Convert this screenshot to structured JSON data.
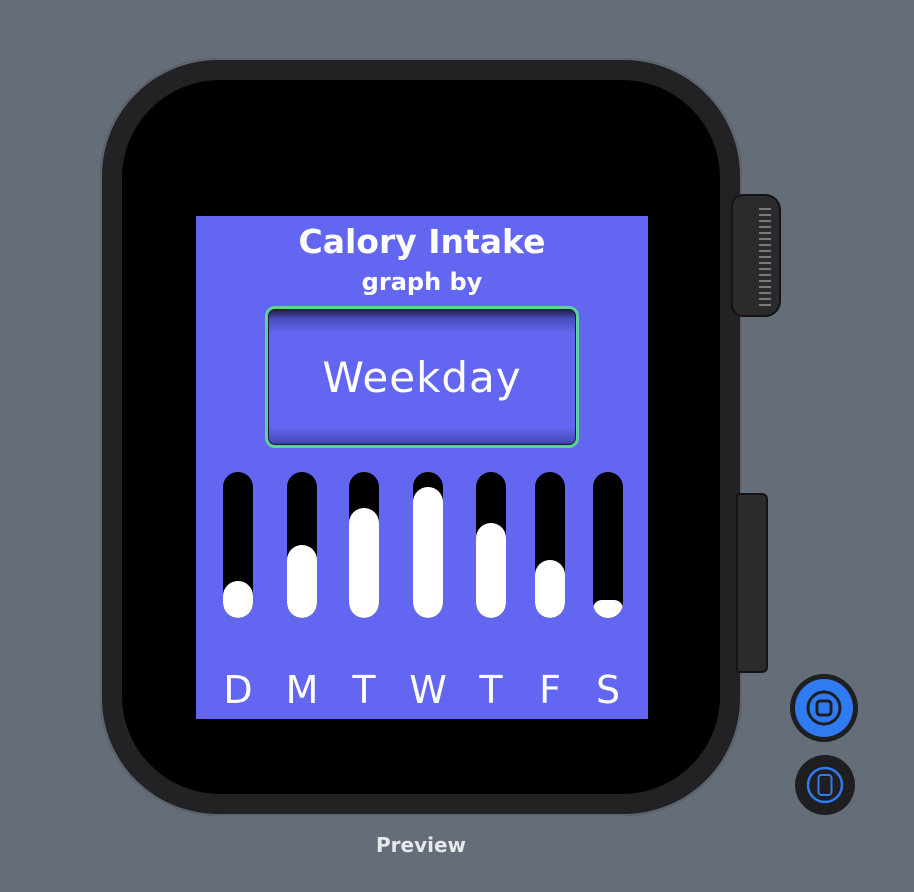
{
  "canvas": {
    "background": "#646d78"
  },
  "app": {
    "title": "Calory Intake",
    "subtitle": "graph by",
    "picker_value": "Weekday",
    "background_color": "#6366f1",
    "picker_border_color": "#5dd39a"
  },
  "days": [
    {
      "label": "D",
      "fill": 0.25
    },
    {
      "label": "M",
      "fill": 0.5
    },
    {
      "label": "T",
      "fill": 0.75
    },
    {
      "label": "W",
      "fill": 0.9
    },
    {
      "label": "T",
      "fill": 0.65
    },
    {
      "label": "F",
      "fill": 0.4
    },
    {
      "label": "S",
      "fill": 0.12
    }
  ],
  "preview": {
    "label": "Preview",
    "live_icon": "live-preview-icon",
    "device_icon": "device-icon"
  },
  "watch": {
    "crown_icon": "digital-crown",
    "side_button_icon": "side-button"
  }
}
